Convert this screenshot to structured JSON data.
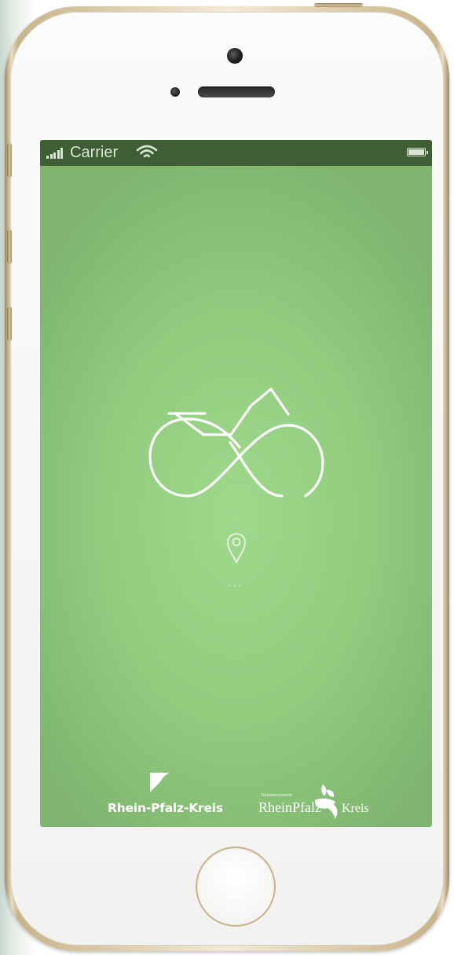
{
  "status_bar": {
    "carrier": "Carrier",
    "signal_icon": "signal-bars-icon",
    "wifi_icon": "wifi-icon",
    "battery_icon": "battery-icon",
    "battery_level": 1.0
  },
  "splash": {
    "app_icon": "bicycle-infinity-icon",
    "location_icon": "map-pin-icon",
    "loading_text": "...",
    "background_color": "#9fd98c",
    "status_bar_color": "#3f5e35"
  },
  "footer": {
    "left_logo": {
      "icon": "rhein-pfalz-kreis-flag-icon",
      "name": "Rhein-Pfalz-Kreis"
    },
    "right_logo": {
      "tagline": "Tourismusverein",
      "name_part1": "RheinPfalz",
      "icon": "leaf-logo-icon",
      "name_part2": "Kreis"
    }
  },
  "device": {
    "frame_color": "#e9dcc0",
    "home_button_icon": "home-button"
  }
}
